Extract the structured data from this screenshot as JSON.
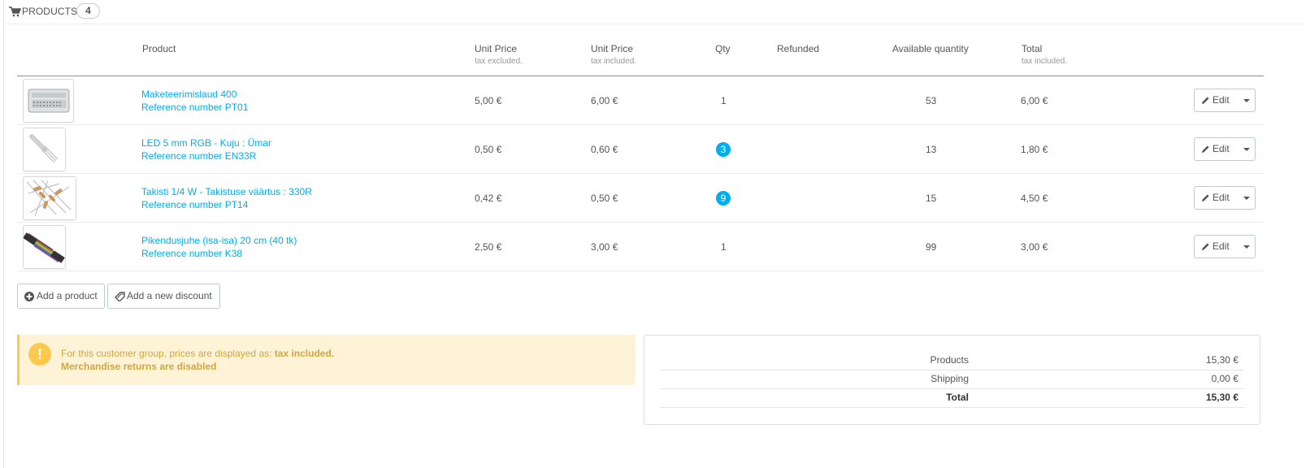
{
  "heading": {
    "title": "PRODUCTS",
    "count": "4"
  },
  "columns": {
    "product": "Product",
    "unit_price_excl": "Unit Price",
    "unit_price_excl_sub": "tax excluded.",
    "unit_price_incl": "Unit Price",
    "unit_price_incl_sub": "tax included.",
    "qty": "Qty",
    "refunded": "Refunded",
    "available": "Available quantity",
    "total": "Total",
    "total_sub": "tax included."
  },
  "products": [
    {
      "name": "Maketeerimislaud 400",
      "reference": "Reference number PT01",
      "unit_excl": "5,00 €",
      "unit_incl": "6,00 €",
      "qty": "1",
      "qty_highlight": false,
      "available": "53",
      "total": "6,00 €",
      "edit": "Edit"
    },
    {
      "name": "LED 5 mm RGB - Kuju : Ümar",
      "reference": "Reference number EN33R",
      "unit_excl": "0,50 €",
      "unit_incl": "0,60 €",
      "qty": "3",
      "qty_highlight": true,
      "available": "13",
      "total": "1,80 €",
      "edit": "Edit"
    },
    {
      "name": "Takisti 1/4 W - Takistuse väärtus : 330R",
      "reference": "Reference number PT14",
      "unit_excl": "0,42 €",
      "unit_incl": "0,50 €",
      "qty": "9",
      "qty_highlight": true,
      "available": "15",
      "total": "4,50 €",
      "edit": "Edit"
    },
    {
      "name": "Pikendusjuhe (isa-isa) 20 cm (40 tk)",
      "reference": "Reference number K38",
      "unit_excl": "2,50 €",
      "unit_incl": "3,00 €",
      "qty": "1",
      "qty_highlight": false,
      "available": "99",
      "total": "3,00 €",
      "edit": "Edit"
    }
  ],
  "actions": {
    "add_product": "Add a product",
    "add_discount": "Add a new discount"
  },
  "alert": {
    "line1_prefix": "For this customer group, prices are displayed as: ",
    "line1_bold": "tax included.",
    "line2": "Merchandise returns are disabled"
  },
  "totals": [
    {
      "label": "Products",
      "value": "15,30 €"
    },
    {
      "label": "Shipping",
      "value": "0,00 €"
    },
    {
      "label": "Total",
      "value": "15,30 €"
    }
  ],
  "colors": {
    "link": "#00aff0",
    "badge": "#00aff0",
    "warning_bg": "#fff3d7",
    "warning_border": "#fcc94f",
    "warning_text": "#d2a63c",
    "header_rule": "#25b9d7"
  },
  "icons": {
    "heading": "shopping-cart-icon",
    "edit": "pencil-icon",
    "add_product": "plus-circle-icon",
    "add_discount": "ticket-icon",
    "alert": "exclamation-icon"
  }
}
